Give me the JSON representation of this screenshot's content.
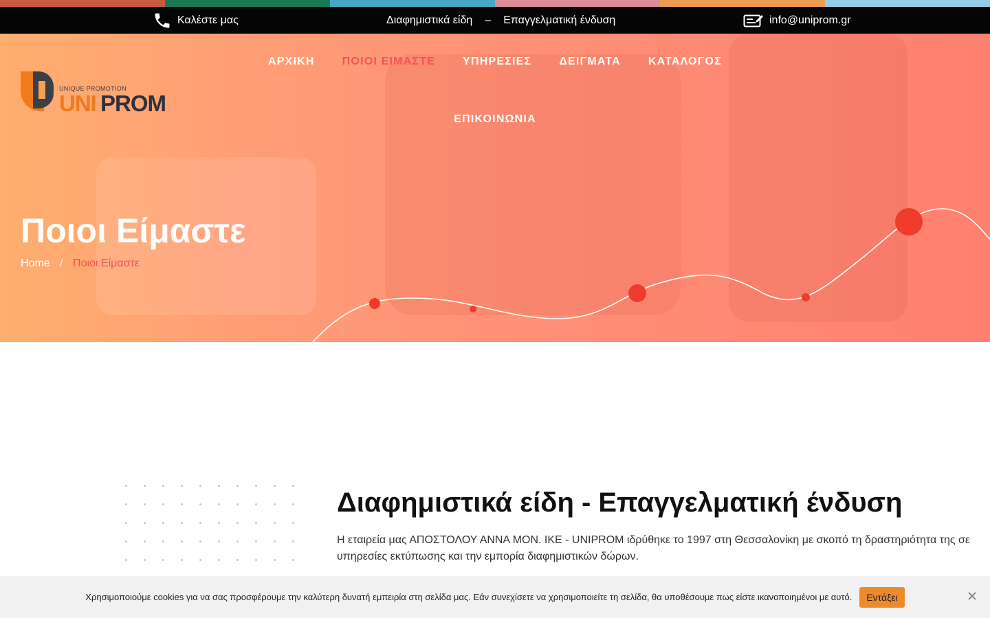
{
  "colors": {
    "bar": [
      "#c75a3f",
      "#1b7a54",
      "#4aa6c6",
      "#d98d9b",
      "#ec9d52",
      "#95cbe6"
    ],
    "active": "#f4525a",
    "accent_red": "#ef3b2c",
    "cookie_button": "#ee8a2a"
  },
  "topbar": {
    "phone_icon": "phone-icon",
    "phone_label": "Καλέστε μας",
    "tagline_left": "Διαφημιστικά είδη",
    "tagline_sep": "–",
    "tagline_right": "Επαγγελματική ένδυση",
    "mail_icon": "email-edit-icon",
    "email": "info@uniprom.gr"
  },
  "logo": {
    "small_text": "UNIQUE PROMOTION",
    "uni": "UNI",
    "prom": "PROM"
  },
  "nav": {
    "items": [
      "ΑΡΧΙΚΗ",
      "ΠΟΙΟΙ ΕΙΜΑΣΤΕ",
      "ΥΠΗΡΕΣΙΕΣ",
      "ΔΕΙΓΜΑΤΑ",
      "ΚΑΤΑΛΟΓΟΣ",
      "ΕΠΙΚΟΙΝΩΝΙΑ"
    ],
    "active_index": 1
  },
  "hero": {
    "title": "Ποιοι Είμαστε",
    "breadcrumb_home": "Home",
    "breadcrumb_sep": "/",
    "breadcrumb_current": "Ποιοι Είμαστε"
  },
  "content": {
    "title": "Διαφημιστικά είδη - Επαγγελματική ένδυση",
    "text": "Η εταιρεία μας ΑΠΟΣΤΟΛΟΥ ΑΝΝΑ ΜΟΝ. ΙΚΕ - UNIPROM ιδρύθηκε το 1997 στη Θεσσαλονίκη με σκοπό τη δραστηριότητα της σε υπηρεσίες εκτύπωσης και την εμπορία διαφημιστικών δώρων."
  },
  "cookie": {
    "text": "Χρησιμοποιούμε cookies για να σας προσφέρουμε την καλύτερη δυνατή εμπειρία στη σελίδα μας. Εάν συνεχίσετε να χρησιμοποιείτε τη σελίδα, θα υποθέσουμε πως είστε ικανοποιημένοι με αυτό.",
    "accept_label": "Εντάξει",
    "close_icon": "close-icon"
  }
}
